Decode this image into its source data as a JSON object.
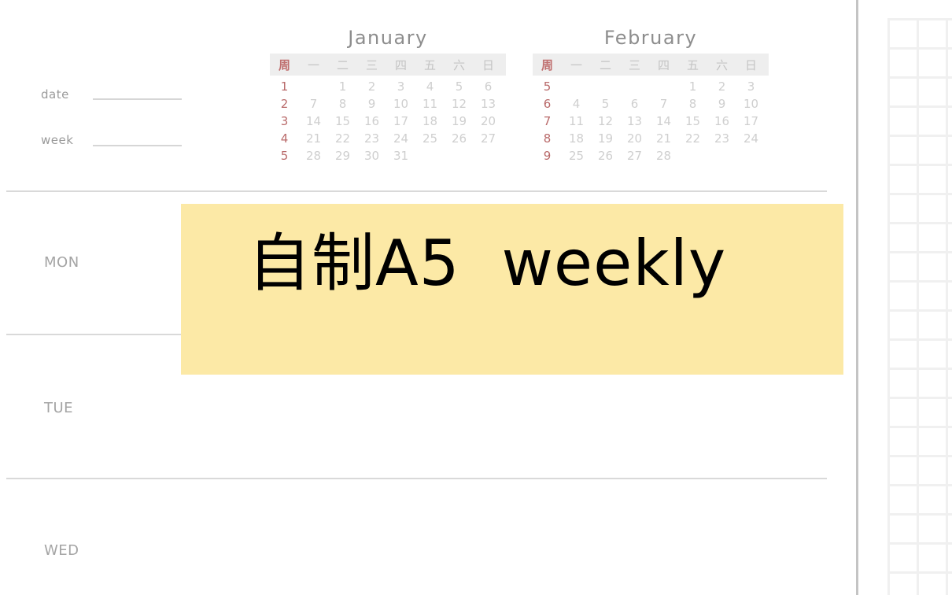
{
  "header": {
    "date_label": "date",
    "week_label": "week"
  },
  "calendars": [
    {
      "title": "January",
      "headers": [
        "周",
        "一",
        "二",
        "三",
        "四",
        "五",
        "六",
        "日"
      ],
      "rows": [
        [
          "1",
          "",
          "1",
          "2",
          "3",
          "4",
          "5",
          "6"
        ],
        [
          "2",
          "7",
          "8",
          "9",
          "10",
          "11",
          "12",
          "13"
        ],
        [
          "3",
          "14",
          "15",
          "16",
          "17",
          "18",
          "19",
          "20"
        ],
        [
          "4",
          "21",
          "22",
          "23",
          "24",
          "25",
          "26",
          "27"
        ],
        [
          "5",
          "28",
          "29",
          "30",
          "31",
          "",
          "",
          ""
        ]
      ]
    },
    {
      "title": "February",
      "headers": [
        "周",
        "一",
        "二",
        "三",
        "四",
        "五",
        "六",
        "日"
      ],
      "rows": [
        [
          "5",
          "",
          "",
          "",
          "",
          "1",
          "2",
          "3"
        ],
        [
          "6",
          "4",
          "5",
          "6",
          "7",
          "8",
          "9",
          "10"
        ],
        [
          "7",
          "11",
          "12",
          "13",
          "14",
          "15",
          "16",
          "17"
        ],
        [
          "8",
          "18",
          "19",
          "20",
          "21",
          "22",
          "23",
          "24"
        ],
        [
          "9",
          "25",
          "26",
          "27",
          "28",
          "",
          "",
          ""
        ]
      ]
    }
  ],
  "days": [
    "MON",
    "TUE",
    "WED"
  ],
  "banner": {
    "text": "自制A5  weekly",
    "color": "#fce9a6"
  },
  "colors": {
    "week_number": "#b96a6a",
    "date_text": "#cfcfcf",
    "rule": "#d9d9d9",
    "grid": "#f0f0f0"
  }
}
